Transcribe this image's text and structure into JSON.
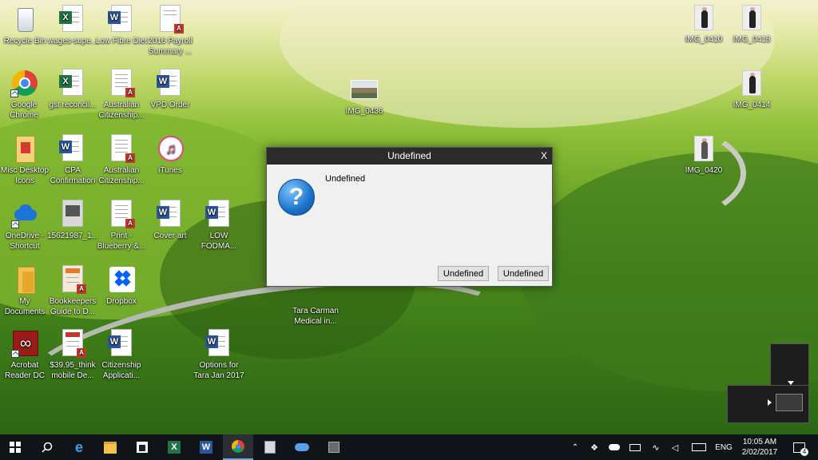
{
  "desktop": {
    "icons": [
      {
        "id": "recycle-bin",
        "label": "Recycle Bin",
        "type": "recycle"
      },
      {
        "id": "wages-super",
        "label": "wages-supe...",
        "type": "excel"
      },
      {
        "id": "low-fibre-diet",
        "label": "Low Fibre Diet",
        "type": "word"
      },
      {
        "id": "payroll-summary",
        "label": "2016 Payroll Summary ...",
        "type": "pdf"
      },
      {
        "id": "google-chrome",
        "label": "Google Chrome",
        "type": "chrome"
      },
      {
        "id": "gst-reconcil",
        "label": "gst reconcil...",
        "type": "excel"
      },
      {
        "id": "australian-citizenship-1",
        "label": "Australian Citizenship...",
        "type": "pdf"
      },
      {
        "id": "vpd-order",
        "label": "VPD Order",
        "type": "word"
      },
      {
        "id": "img-0436",
        "label": "IMG_0436",
        "type": "photo-landscape"
      },
      {
        "id": "misc-desktop-icons",
        "label": "Misc Desktop Icons",
        "type": "misc"
      },
      {
        "id": "cpa-confirmation",
        "label": "CPA Confirmation",
        "type": "word"
      },
      {
        "id": "australian-citizenship-2",
        "label": "Australian Citizenship...",
        "type": "pdf"
      },
      {
        "id": "itunes",
        "label": "iTunes",
        "type": "itunes"
      },
      {
        "id": "onedrive",
        "label": "OneDrive - Shortcut",
        "type": "onedrive"
      },
      {
        "id": "file-15621987",
        "label": "15621987_1...",
        "type": "image-doc"
      },
      {
        "id": "print-blueberry",
        "label": "Print - Blueberry &...",
        "type": "pdf"
      },
      {
        "id": "cover-art",
        "label": "Cover art",
        "type": "word"
      },
      {
        "id": "low-fodma",
        "label": "LOW FODMA...",
        "type": "word"
      },
      {
        "id": "my-documents",
        "label": "My Documents",
        "type": "folder"
      },
      {
        "id": "bookkeepers-guide",
        "label": "Bookkeepers Guide to D...",
        "type": "pdf"
      },
      {
        "id": "dropbox",
        "label": "Dropbox",
        "type": "dropbox"
      },
      {
        "id": "tara-carman",
        "label": "Tara Carman Medical in...",
        "type": "hidden"
      },
      {
        "id": "acrobat-reader",
        "label": "Acrobat Reader DC",
        "type": "acrobat"
      },
      {
        "id": "think-mobile",
        "label": "$39.95_think mobile De...",
        "type": "pdf"
      },
      {
        "id": "citizenship-application",
        "label": "Citizenship Applicati...",
        "type": "word"
      },
      {
        "id": "options-for-tara",
        "label": "Options for Tara Jan 2017",
        "type": "word"
      },
      {
        "id": "img-0410",
        "label": "IMG_0410",
        "type": "photo"
      },
      {
        "id": "img-0418",
        "label": "IMG_0418",
        "type": "photo"
      },
      {
        "id": "img-0414",
        "label": "IMG_0414",
        "type": "photo"
      },
      {
        "id": "img-0420",
        "label": "IMG_0420",
        "type": "photo"
      }
    ]
  },
  "dialog": {
    "title": "Undefined",
    "close": "X",
    "message": "Undefined",
    "button1": "Undefined",
    "button2": "Undefined"
  },
  "taskbar": {
    "time": "10:05 AM",
    "date": "2/02/2017",
    "language": "ENG",
    "notifications": "4"
  },
  "colors": {
    "dialog_title_bg": "#2b2b2b",
    "taskbar_bg": "#101418",
    "word": "#2b579a",
    "excel": "#217346",
    "pdf": "#c0392b"
  }
}
